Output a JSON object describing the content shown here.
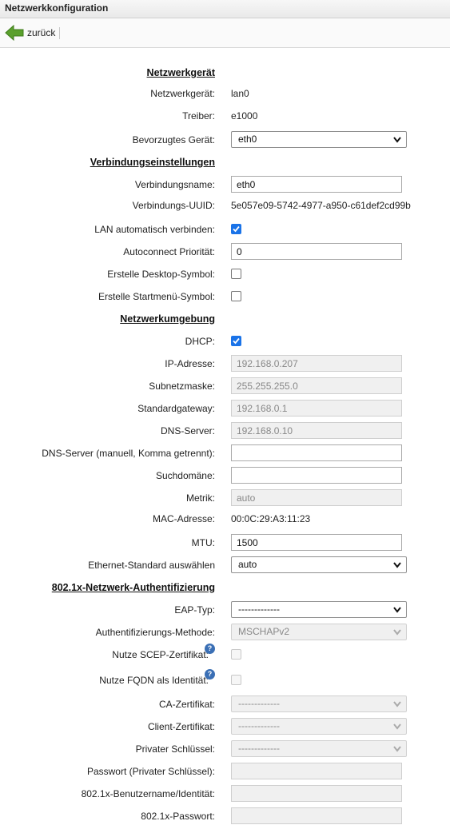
{
  "window": {
    "title": "Netzwerkkonfiguration"
  },
  "toolbar": {
    "back_label": "zurück",
    "back_icon": "arrow-left-icon",
    "accent": "#5aa02c"
  },
  "sections": {
    "device": "Netzwerkgerät",
    "connection": "Verbindungseinstellungen",
    "environment": "Netzwerkumgebung",
    "auth": "802.1x-Netzwerk-Authentifizierung"
  },
  "fields": {
    "device_label": "Netzwerkgerät:",
    "device_value": "lan0",
    "driver_label": "Treiber:",
    "driver_value": "e1000",
    "preferred_label": "Bevorzugtes Gerät:",
    "preferred_value": "eth0",
    "conn_name_label": "Verbindungsname:",
    "conn_name_value": "eth0",
    "uuid_label": "Verbindungs-UUID:",
    "uuid_value": "5e057e09-5742-4977-a950-c61def2cd99b",
    "autoconnect_label": "LAN automatisch verbinden:",
    "autoconnect_checked": true,
    "autoconnect_prio_label": "Autoconnect Priorität:",
    "autoconnect_prio_value": "0",
    "desktop_icon_label": "Erstelle Desktop-Symbol:",
    "desktop_icon_checked": false,
    "startmenu_icon_label": "Erstelle Startmenü-Symbol:",
    "startmenu_icon_checked": false,
    "dhcp_label": "DHCP:",
    "dhcp_checked": true,
    "ip_label": "IP-Adresse:",
    "ip_value": "192.168.0.207",
    "subnet_label": "Subnetzmaske:",
    "subnet_value": "255.255.255.0",
    "gateway_label": "Standardgateway:",
    "gateway_value": "192.168.0.1",
    "dns_label": "DNS-Server:",
    "dns_value": "192.168.0.10",
    "dns_manual_label": "DNS-Server (manuell, Komma getrennt):",
    "dns_manual_value": "",
    "search_domain_label": "Suchdomäne:",
    "search_domain_value": "",
    "metric_label": "Metrik:",
    "metric_value": "auto",
    "mac_label": "MAC-Adresse:",
    "mac_value": "00:0C:29:A3:11:23",
    "mtu_label": "MTU:",
    "mtu_value": "1500",
    "ethernet_label": "Ethernet-Standard auswählen",
    "ethernet_value": "auto",
    "eap_label": "EAP-Typ:",
    "eap_value": "-------------",
    "auth_method_label": "Authentifizierungs-Methode:",
    "auth_method_value": "MSCHAPv2",
    "scep_label": "Nutze SCEP-Zertifikat:",
    "scep_checked": false,
    "fqdn_label": "Nutze FQDN als Identität:",
    "fqdn_checked": false,
    "ca_label": "CA-Zertifikat:",
    "ca_value": "-------------",
    "client_cert_label": "Client-Zertifikat:",
    "client_cert_value": "-------------",
    "private_key_label": "Privater Schlüssel:",
    "private_key_value": "-------------",
    "key_password_label": "Passwort (Privater Schlüssel):",
    "key_password_value": "",
    "identity_label": "802.1x-Benutzername/Identität:",
    "identity_value": "",
    "password_label": "802.1x-Passwort:",
    "password_value": ""
  },
  "help_glyph": "?"
}
